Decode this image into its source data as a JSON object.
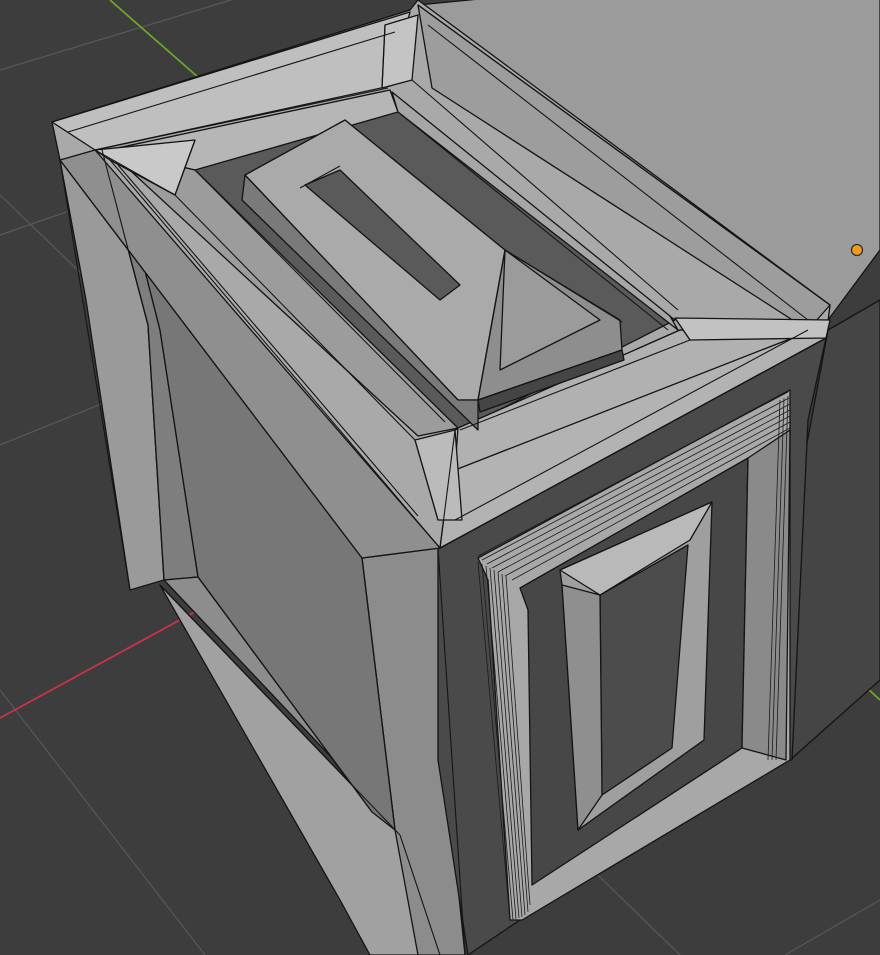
{
  "app": "3D viewport",
  "view": {
    "mode": "object",
    "shading": "solid",
    "background": "#3d3d3d",
    "grid_color": "#575757",
    "axis_x_color": "#c8344a",
    "axis_y_color": "#6fa52a",
    "object_origin_color": "#f09b1c",
    "mesh_light": "#a3a3a3",
    "mesh_mid": "#8a8a8a",
    "mesh_dark": "#474747",
    "wire_color": "#141414"
  }
}
